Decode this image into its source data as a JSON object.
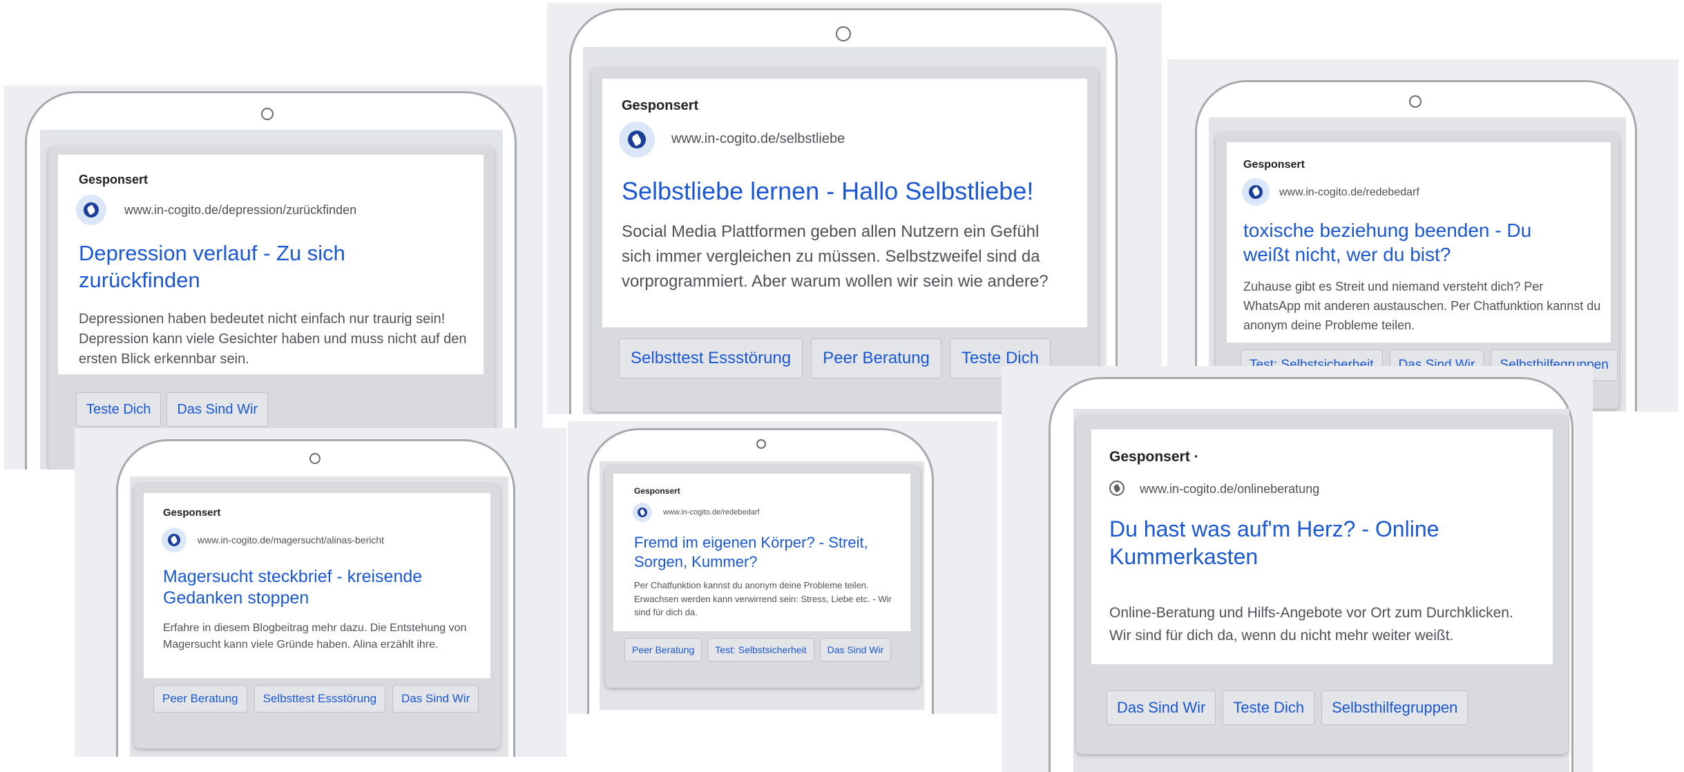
{
  "ads": [
    {
      "sponsored": "Gesponsert",
      "url": "www.in-cogito.de/depression/zurückfinden",
      "headline": "Depression verlauf - Zu sich zurückfinden",
      "description": "Depressionen haben bedeutet nicht einfach nur traurig sein! Depression kann viele Gesichter haben und muss nicht auf den ersten Blick erkennbar sein.",
      "buttons": [
        "Teste Dich",
        "Das Sind Wir"
      ]
    },
    {
      "sponsored": "Gesponsert",
      "url": "www.in-cogito.de/selbstliebe",
      "headline": "Selbstliebe lernen - Hallo Selbstliebe!",
      "description": "Social Media Plattformen geben allen Nutzern ein Gefühl sich immer vergleichen zu müssen. Selbstzweifel sind da vorprogrammiert. Aber warum wollen wir sein wie andere?",
      "buttons": [
        "Selbsttest Essstörung",
        "Peer Beratung",
        "Teste Dich"
      ]
    },
    {
      "sponsored": "Gesponsert",
      "url": "www.in-cogito.de/redebedarf",
      "headline": "toxische beziehung beenden - Du weißt nicht, wer du bist?",
      "description": "Zuhause gibt es Streit und niemand versteht dich? Per WhatsApp mit anderen austauschen. Per Chatfunktion kannst du anonym deine Probleme teilen.",
      "buttons": [
        "Test: Selbstsicherheit",
        "Das Sind Wir",
        "Selbsthilfegruppen"
      ]
    },
    {
      "sponsored": "Gesponsert",
      "url": "www.in-cogito.de/magersucht/alinas-bericht",
      "headline": "Magersucht steckbrief - kreisende Gedanken stoppen",
      "description": "Erfahre in diesem Blogbeitrag mehr dazu. Die Entstehung von Magersucht kann viele Gründe haben. Alina erzählt ihre.",
      "buttons": [
        "Peer Beratung",
        "Selbsttest Essstörung",
        "Das Sind Wir"
      ]
    },
    {
      "sponsored": "Gesponsert",
      "url": "www.in-cogito.de/redebedarf",
      "headline": "Fremd im eigenen Körper? - Streit, Sorgen, Kummer?",
      "description": "Per Chatfunktion kannst du anonym deine Probleme teilen. Erwachsen werden kann verwirrend sein: Stress, Liebe etc. - Wir sind für dich da.",
      "buttons": [
        "Peer Beratung",
        "Test: Selbstsicherheit",
        "Das Sind Wir"
      ]
    },
    {
      "sponsored": "Gesponsert ·",
      "url": "www.in-cogito.de/onlineberatung",
      "headline": "Du hast was auf'm Herz? - Online Kummerkasten",
      "description": "Online-Beratung und Hilfs-Angebote vor Ort zum Durchklicken. Wir sind für dich da, wenn du nicht mehr weiter weißt.",
      "buttons": [
        "Das Sind Wir",
        "Teste Dich",
        "Selbsthilfegruppen"
      ]
    }
  ]
}
